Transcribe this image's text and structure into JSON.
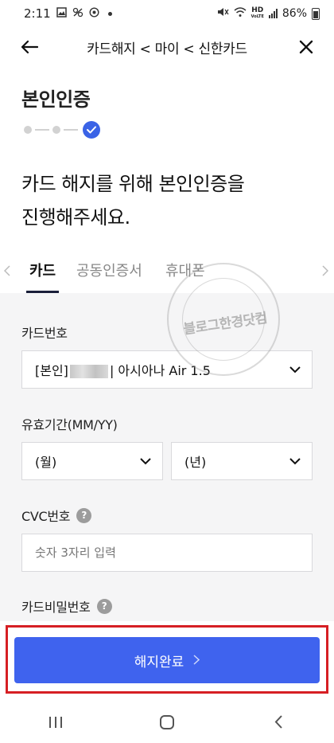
{
  "status_bar": {
    "time": "2:11",
    "battery": "86%",
    "hd_label": "HD",
    "volte_label": "VoLTE"
  },
  "header": {
    "title": "카드해지 < 마이 < 신한카드"
  },
  "page_title": "본인인증",
  "intro": {
    "line1": "카드 해지를 위해 본인인증을",
    "line2": "진행해주세요."
  },
  "tabs": [
    {
      "label": "카드"
    },
    {
      "label": "공동인증서"
    },
    {
      "label": "휴대폰"
    }
  ],
  "form": {
    "card_number": {
      "label": "카드번호",
      "value_prefix": "[본인]",
      "value_suffix": "| 아시아나 Air 1.5"
    },
    "expiry": {
      "label": "유효기간(MM/YY)",
      "month_value": "(월)",
      "year_value": "(년)"
    },
    "cvc": {
      "label": "CVC번호",
      "help": "?",
      "placeholder": "숫자 3자리 입력"
    },
    "card_password": {
      "label": "카드비밀번호",
      "help": "?"
    }
  },
  "watermark": {
    "text": "블로그한경닷컴"
  },
  "cta": {
    "label": "해지완료",
    "chevron": ">"
  },
  "colors": {
    "accent": "#3f63ee",
    "highlight": "#d61f24",
    "step_done": "#3a63e6"
  }
}
